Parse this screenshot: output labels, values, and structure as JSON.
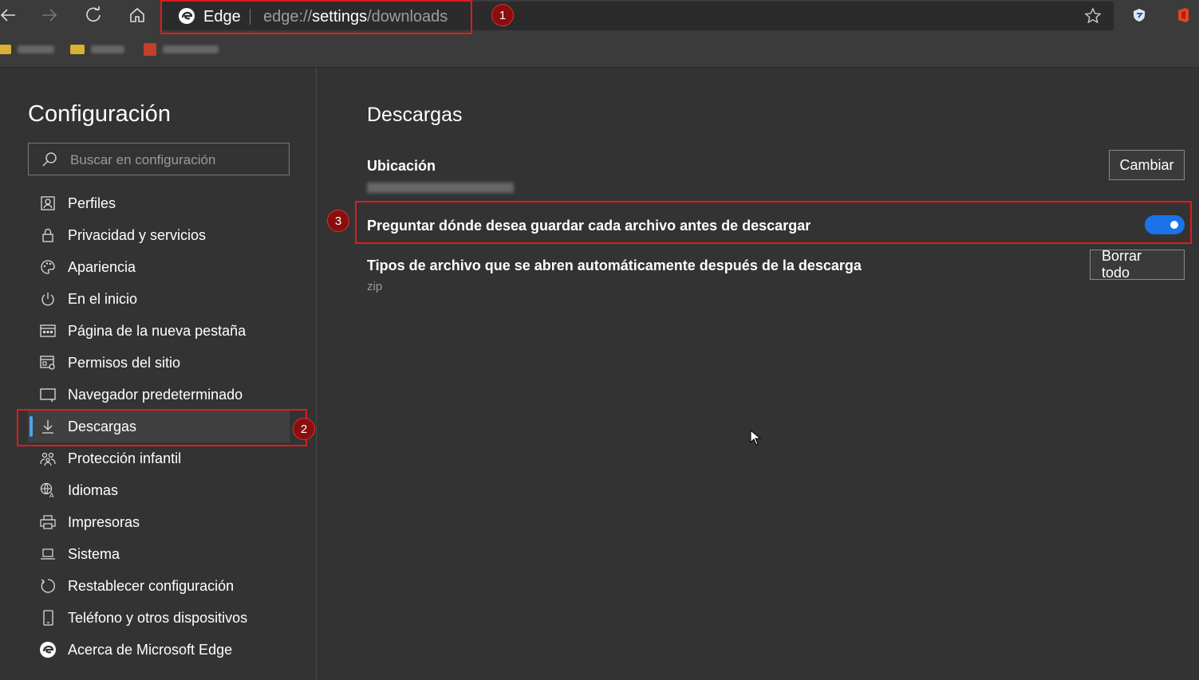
{
  "browser": {
    "app_name": "Edge",
    "url_prefix": "edge://",
    "url_highlight": "settings",
    "url_suffix": "/downloads",
    "bookmarks": [
      {
        "color": "#d8b234"
      },
      {
        "color": "#d8b234"
      },
      {
        "color": "#c2402a"
      }
    ]
  },
  "sidebar": {
    "title": "Configuración",
    "search_placeholder": "Buscar en configuración",
    "items": [
      {
        "label": "Perfiles",
        "icon": "profile-icon"
      },
      {
        "label": "Privacidad y servicios",
        "icon": "lock-icon"
      },
      {
        "label": "Apariencia",
        "icon": "palette-icon"
      },
      {
        "label": "En el inicio",
        "icon": "power-icon"
      },
      {
        "label": "Página de la nueva pestaña",
        "icon": "new-tab-icon"
      },
      {
        "label": "Permisos del sitio",
        "icon": "site-permissions-icon"
      },
      {
        "label": "Navegador predeterminado",
        "icon": "default-browser-icon"
      },
      {
        "label": "Descargas",
        "icon": "download-icon",
        "active": true
      },
      {
        "label": "Protección infantil",
        "icon": "family-icon"
      },
      {
        "label": "Idiomas",
        "icon": "language-icon"
      },
      {
        "label": "Impresoras",
        "icon": "printer-icon"
      },
      {
        "label": "Sistema",
        "icon": "laptop-icon"
      },
      {
        "label": "Restablecer configuración",
        "icon": "reset-icon"
      },
      {
        "label": "Teléfono y otros dispositivos",
        "icon": "phone-icon"
      },
      {
        "label": "Acerca de Microsoft Edge",
        "icon": "edge-logo-icon"
      }
    ]
  },
  "main": {
    "title": "Descargas",
    "location_label": "Ubicación",
    "change_button": "Cambiar",
    "ask_label": "Preguntar dónde desea guardar cada archivo antes de descargar",
    "ask_enabled": true,
    "auto_open_label": "Tipos de archivo que se abren automáticamente después de la descarga",
    "auto_open_types": "zip",
    "clear_button": "Borrar todo"
  },
  "annotations": {
    "badge_1": "1",
    "badge_2": "2",
    "badge_3": "3",
    "color": "#e01b1b"
  }
}
